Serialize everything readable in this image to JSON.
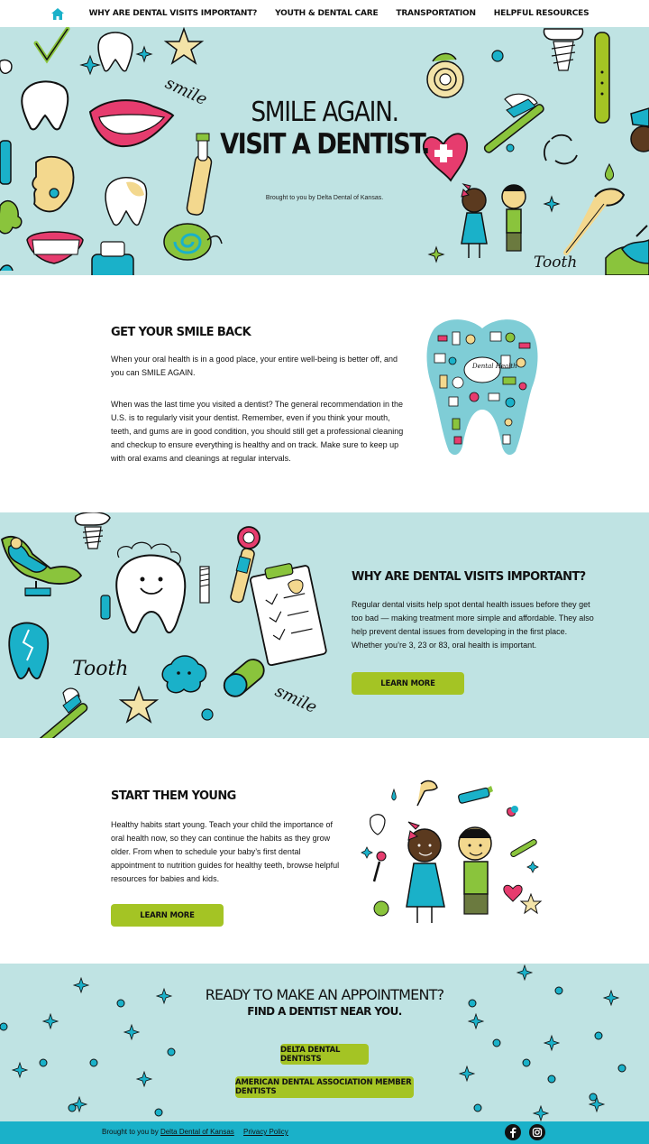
{
  "nav": {
    "items": [
      "Why are dental visits important?",
      "Youth & Dental Care",
      "Transportation",
      "Helpful Resources"
    ],
    "home_icon": "home-icon",
    "accent": "#1ab1c9"
  },
  "hero": {
    "title_line1": "SMILE AGAIN.",
    "title_line2": "VISIT A DENTIST.",
    "subtitle": "Brought to you by Delta Dental of Kansas.",
    "doodle_smile": "smile",
    "doodle_tooth": "Tooth",
    "background": "#bfe3e3"
  },
  "smile_back": {
    "heading": "GET YOUR SMILE BACK",
    "para1": "When your oral health is in a good place, your entire well-being is better off, and you can SMILE AGAIN.",
    "para2": "When was the last time you visited a dentist? The general recommendation in the U.S. is to regularly visit your dentist. Remember, even if you think your mouth, teeth, and gums are in good condition, you should still get a professional cleaning and checkup to ensure everything is healthy and on track. Make sure to keep up with oral exams and cleanings at regular intervals.",
    "tooth_text": "Dental Health"
  },
  "visits": {
    "heading": "WHY ARE DENTAL VISITS IMPORTANT?",
    "para": "Regular dental visits help spot dental health issues before they get too bad — making treatment more simple and affordable. They also help prevent dental issues from developing in the first place. Whether you’re 3, 23 or 83, oral health is important.",
    "button": "LEARN MORE",
    "doodle_tooth": "Tooth",
    "doodle_smile": "smile"
  },
  "young": {
    "heading": "START THEM YOUNG",
    "para": "Healthy habits start young. Teach your child the importance of oral health now, so they can continue the habits as they grow older. From when to schedule your baby’s first dental appointment to nutrition guides for healthy teeth, browse helpful resources for babies and kids.",
    "button": "LEARN MORE"
  },
  "cta": {
    "title": "READY TO MAKE AN APPOINTMENT?",
    "subtitle": "FIND A DENTIST NEAR YOU.",
    "button1": "DELTA DENTAL DENTISTS",
    "button2": "AMERICAN DENTAL ASSOCIATION MEMBER DENTISTS"
  },
  "footer": {
    "prefix": "Brought to you by",
    "link": "Delta Dental of Kansas",
    "privacy": "Privacy Policy",
    "icons": [
      "facebook-icon",
      "instagram-icon"
    ],
    "background": "#1ab1c9"
  },
  "colors": {
    "button_green": "#a4c424",
    "light_teal": "#bfe3e3",
    "footer_teal": "#1ab1c9"
  }
}
